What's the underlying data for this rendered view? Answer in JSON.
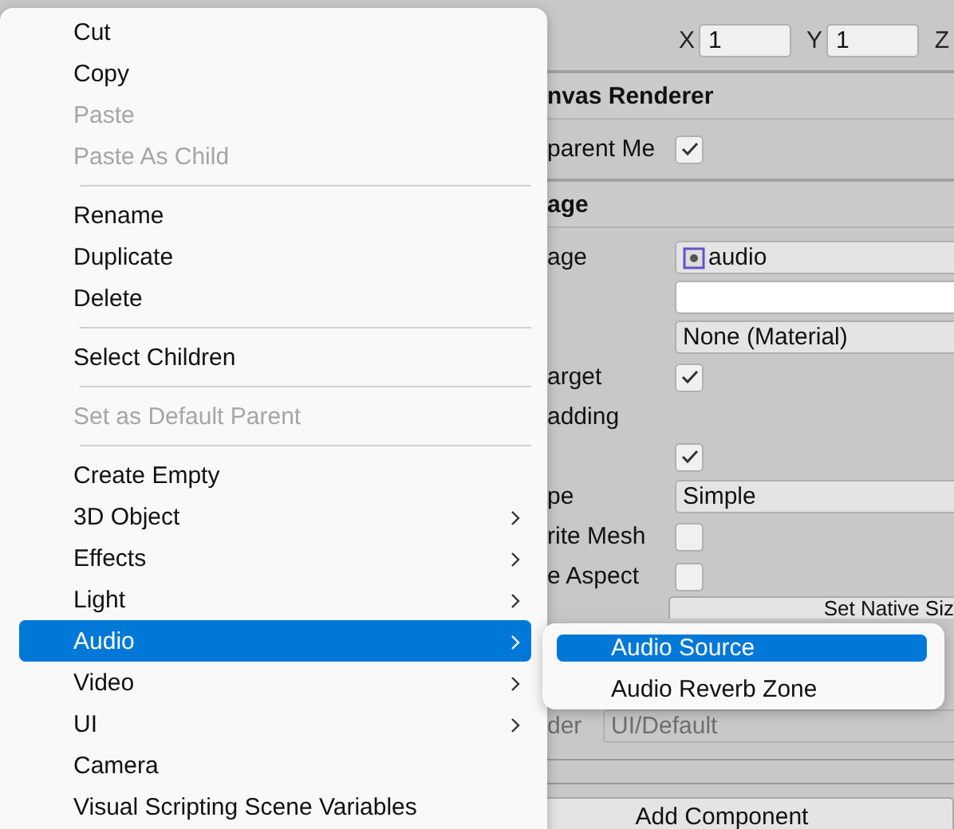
{
  "inspector": {
    "rows": [
      {
        "kind": "vector",
        "fields": [
          {
            "axis": "X",
            "value": "1"
          },
          {
            "axis": "Y",
            "value": "1"
          },
          {
            "axis": "Z"
          }
        ]
      },
      {
        "kind": "header",
        "label": "nvas Renderer"
      },
      {
        "kind": "checkbox",
        "label": "parent Me",
        "checked": true
      },
      {
        "kind": "header",
        "label": "age"
      },
      {
        "kind": "object",
        "label": "age",
        "value": "audio"
      },
      {
        "kind": "color"
      },
      {
        "kind": "object",
        "value": "None (Material)"
      },
      {
        "kind": "checkbox",
        "label": "arget",
        "checked": true
      },
      {
        "kind": "label",
        "label": "adding"
      },
      {
        "kind": "checkbox",
        "checked": true
      },
      {
        "kind": "dropdown",
        "label": "pe",
        "value": "Simple",
        "disabled": false
      },
      {
        "kind": "checkbox",
        "label": "rite Mesh",
        "checked": false
      },
      {
        "kind": "checkbox",
        "label": "e Aspect",
        "checked": false
      },
      {
        "kind": "button",
        "label": "Set Native Siz"
      },
      {
        "kind": "gap"
      },
      {
        "kind": "dropdown",
        "label": "der",
        "value": "UI/Default",
        "disabled": true
      },
      {
        "kind": "rule"
      },
      {
        "kind": "wide_button",
        "label": "Add Component"
      }
    ]
  },
  "menu": {
    "groups": [
      [
        {
          "label": "Cut",
          "disabled": false
        },
        {
          "label": "Copy",
          "disabled": false
        },
        {
          "label": "Paste",
          "disabled": true
        },
        {
          "label": "Paste As Child",
          "disabled": true
        }
      ],
      [
        {
          "label": "Rename",
          "disabled": false
        },
        {
          "label": "Duplicate",
          "disabled": false
        },
        {
          "label": "Delete",
          "disabled": false
        }
      ],
      [
        {
          "label": "Select Children",
          "disabled": false
        }
      ],
      [
        {
          "label": "Set as Default Parent",
          "disabled": true
        }
      ],
      [
        {
          "label": "Create Empty",
          "disabled": false,
          "submenu": false,
          "selected": false
        },
        {
          "label": "3D Object",
          "disabled": false,
          "submenu": true,
          "selected": false
        },
        {
          "label": "Effects",
          "disabled": false,
          "submenu": true,
          "selected": false
        },
        {
          "label": "Light",
          "disabled": false,
          "submenu": true,
          "selected": false
        },
        {
          "label": "Audio",
          "disabled": false,
          "submenu": true,
          "selected": true
        },
        {
          "label": "Video",
          "disabled": false,
          "submenu": true,
          "selected": false
        },
        {
          "label": "UI",
          "disabled": false,
          "submenu": true,
          "selected": false
        },
        {
          "label": "Camera",
          "disabled": false,
          "submenu": false,
          "selected": false
        },
        {
          "label": "Visual Scripting Scene Variables",
          "disabled": false,
          "submenu": false,
          "selected": false
        }
      ]
    ]
  },
  "submenu": {
    "items": [
      {
        "label": "Audio Source",
        "selected": true
      },
      {
        "label": "Audio Reverb Zone",
        "selected": false
      }
    ]
  }
}
